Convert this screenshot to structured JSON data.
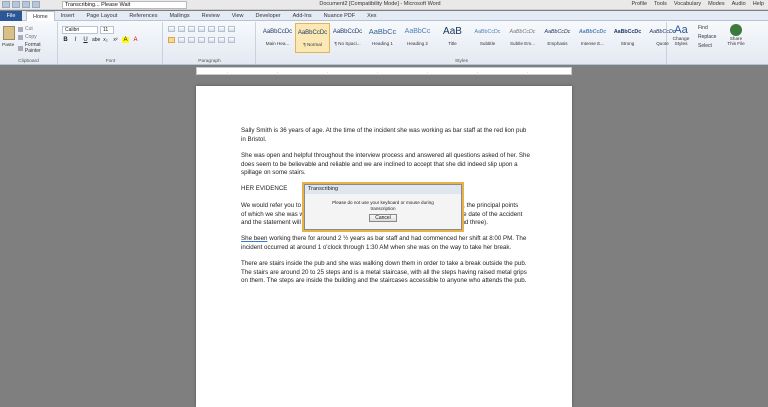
{
  "window": {
    "title": "Document2 [Compatibility Mode] - Microsoft Word",
    "search_text": "Transcribing... Please Wait",
    "top_menu": [
      "Profile",
      "Tools",
      "Vocabulary",
      "Modes",
      "Audio",
      "Help"
    ]
  },
  "ribbon_tabs": [
    "File",
    "Home",
    "Insert",
    "Page Layout",
    "References",
    "Mailings",
    "Review",
    "View",
    "Developer",
    "Add-Ins",
    "Nuance PDF",
    "Xex"
  ],
  "active_tab": "Home",
  "clipboard": {
    "paste_label": "Paste",
    "cut_label": "Cut",
    "copy_label": "Copy",
    "format_painter_label": "Format Painter",
    "group_label": "Clipboard"
  },
  "font": {
    "font_name": "Calibri",
    "font_size": "11",
    "buttons": [
      "B",
      "I",
      "U",
      "abe",
      "x₂",
      "x²",
      "A",
      "A"
    ],
    "group_label": "Font"
  },
  "paragraph": {
    "group_label": "Paragraph"
  },
  "styles": {
    "items": [
      {
        "preview": "AaBbCcDc",
        "name": "Main Hea..."
      },
      {
        "preview": "AaBbCcDc",
        "name": "¶ Normal"
      },
      {
        "preview": "AaBbCcDc",
        "name": "¶ No Spaci..."
      },
      {
        "preview": "AaBbCc",
        "name": "Heading 1"
      },
      {
        "preview": "AaBbCc",
        "name": "Heading 2"
      },
      {
        "preview": "AaB",
        "name": "Title"
      },
      {
        "preview": "AaBbCcDc",
        "name": "Subtitle"
      },
      {
        "preview": "AaBbCcDc",
        "name": "Subtle Em..."
      },
      {
        "preview": "AaBbCcDc",
        "name": "Emphasis"
      },
      {
        "preview": "AaBbCcDc",
        "name": "Intense E..."
      },
      {
        "preview": "AaBbCcDc",
        "name": "Strong"
      },
      {
        "preview": "AaBbCcDc",
        "name": "Quote"
      },
      {
        "preview": "AaBbCcDc",
        "name": "Intense Q..."
      },
      {
        "preview": "AaBbCcDc",
        "name": "Subtle Ref..."
      }
    ],
    "change_styles_label": "Change Styles",
    "group_label": "Styles"
  },
  "editing": {
    "find_label": "Find",
    "replace_label": "Replace",
    "select_label": "Select",
    "group_label": "Editing"
  },
  "share": {
    "label": "Share This File",
    "group_label": "WebEx"
  },
  "document": {
    "p1": "Sally Smith is 36 years of age. At the time of the incident she was working as bar staff at the red lion pub in Bristol.",
    "p2": "She was open and helpful throughout the interview process and answered all questions asked of her. She does seem to be believable and reliable and we are inclined to accept that she did indeed slip upon a spillage on some stairs.",
    "p3": "HER EVIDENCE",
    "p4a": "We would refer you to",
    "p4b": "to, the principal points",
    "p4c": "of which we she was w",
    "p4d": "the date of the accident",
    "p4e": "and the statement will",
    "p4f": "and three).",
    "p5_underlined": "She been",
    "p5_rest": " working there for around 2 ½ years as bar staff and had commenced her shift at 8:00 PM. The incident occurred at around 1 o'clock through 1:30 AM when she was on the way to take her break.",
    "p6": "There are stairs inside the pub and she was walking down them in order to take a break outside the pub. The stairs are around 20 to 25 steps and is a metal staircase, with all the steps having raised metal grips on them. The steps are inside the building and the staircases accessible to anyone who attends the pub."
  },
  "dialog": {
    "title": "Transcribing",
    "message": "Please do not use your keyboard or mouse during transcription",
    "cancel_label": "Cancel"
  }
}
